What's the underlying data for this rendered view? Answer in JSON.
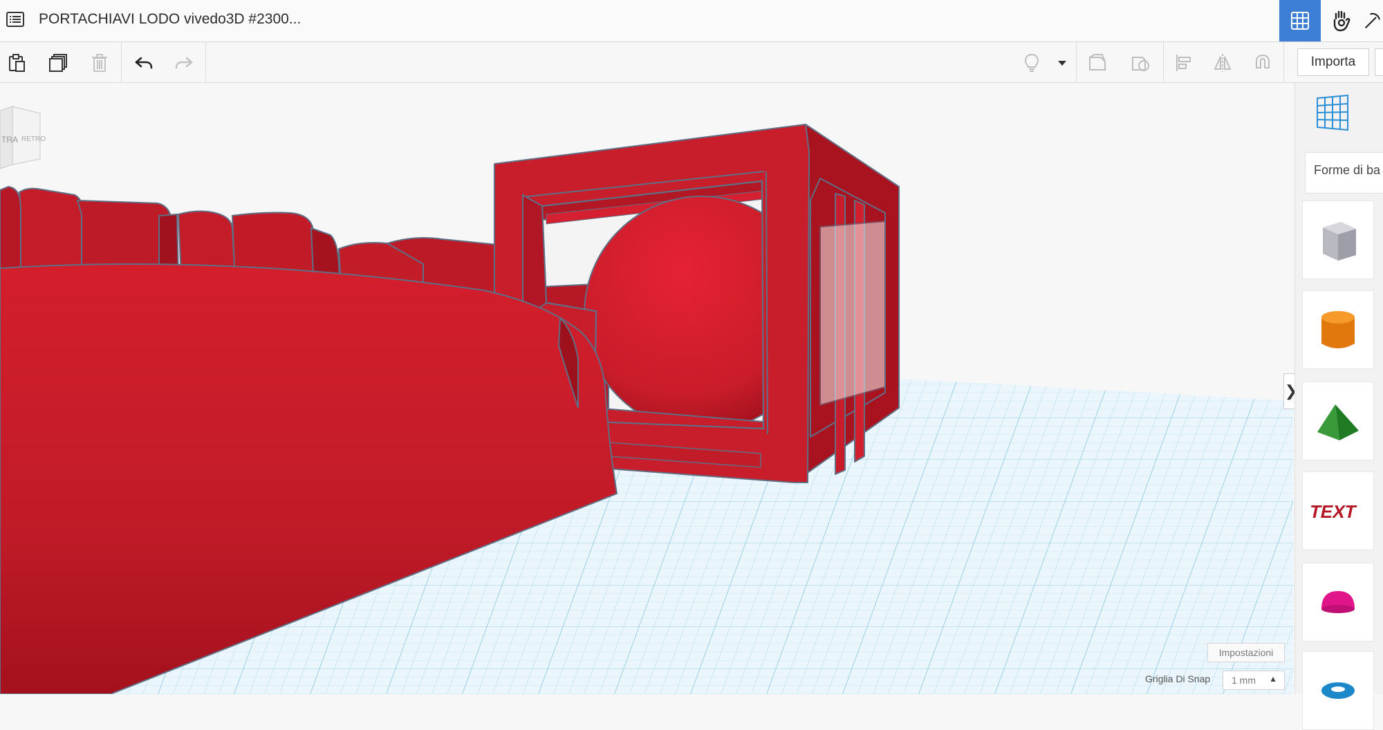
{
  "header": {
    "title": "PORTACHIAVI LODO vivedo3D #2300...",
    "menu_icon": "list-icon",
    "view_buttons": [
      {
        "name": "grid-view-icon",
        "active": true
      },
      {
        "name": "hand-tool-icon",
        "active": false
      },
      {
        "name": "pickaxe-icon",
        "active": false
      }
    ]
  },
  "toolbar": {
    "left_tools": [
      "paste-icon",
      "duplicate-icon",
      "trash-icon",
      "undo-icon",
      "redo-icon"
    ],
    "right_tools": [
      "light-bulb-icon",
      "dropdown-arrow-icon",
      "group-icon",
      "ungroup-icon",
      "align-icon",
      "mirror-icon",
      "magnet-icon"
    ],
    "import_label": "Importa"
  },
  "viewcube": {
    "labels": [
      "TRA",
      "RETRO"
    ]
  },
  "sidebar": {
    "workplane_icon": "workplane-grid-icon",
    "category_label": "Forme di ba",
    "shapes": [
      "box-icon",
      "cylinder-icon",
      "roof-icon",
      "text-icon",
      "half-sphere-icon",
      "torus-icon"
    ],
    "text_shape_label": "TEXT"
  },
  "footer": {
    "settings_label": "Impostazioni",
    "snap_label": "Griglia Di Snap",
    "snap_value": "1 mm"
  },
  "colors": {
    "accent": "#3d7fd6",
    "model_red": "#c81f2c",
    "grid_blue": "#9fd3ea"
  }
}
